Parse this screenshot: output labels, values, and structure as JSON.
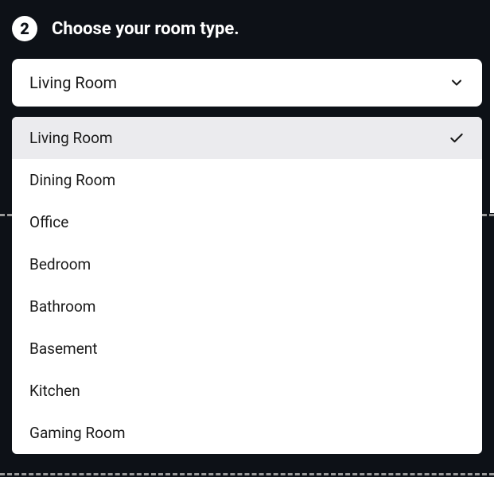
{
  "step": {
    "number": "2",
    "title": "Choose your room type."
  },
  "select": {
    "value": "Living Room"
  },
  "options": [
    {
      "label": "Living Room",
      "selected": true
    },
    {
      "label": "Dining Room",
      "selected": false
    },
    {
      "label": "Office",
      "selected": false
    },
    {
      "label": "Bedroom",
      "selected": false
    },
    {
      "label": "Bathroom",
      "selected": false
    },
    {
      "label": "Basement",
      "selected": false
    },
    {
      "label": "Kitchen",
      "selected": false
    },
    {
      "label": "Gaming Room",
      "selected": false
    }
  ]
}
